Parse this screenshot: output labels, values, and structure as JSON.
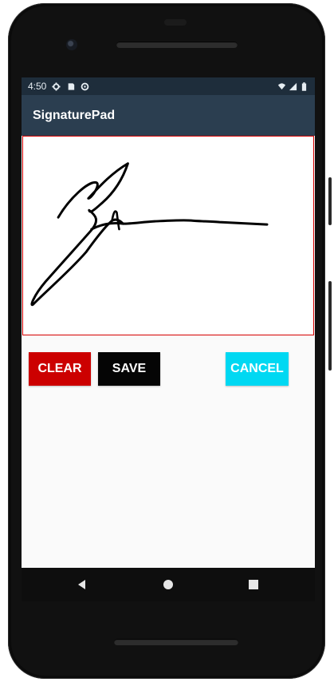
{
  "status_bar": {
    "time": "4:50",
    "icons_left": [
      "settings-icon",
      "sd-card-icon",
      "sync-icon"
    ],
    "icons_right": [
      "wifi-icon",
      "cellular-icon",
      "battery-icon"
    ]
  },
  "app_bar": {
    "title": "SignaturePad"
  },
  "buttons": {
    "clear": "CLEAR",
    "save": "SAVE",
    "cancel": "CANCEL"
  },
  "colors": {
    "status_bar": "#1e2d3b",
    "app_bar": "#2b3e50",
    "clear": "#cc0000",
    "save": "#050505",
    "cancel": "#00d8f2",
    "pad_border": "#d50000"
  },
  "navigation": {
    "items": [
      "back-icon",
      "home-icon",
      "recents-icon"
    ]
  }
}
